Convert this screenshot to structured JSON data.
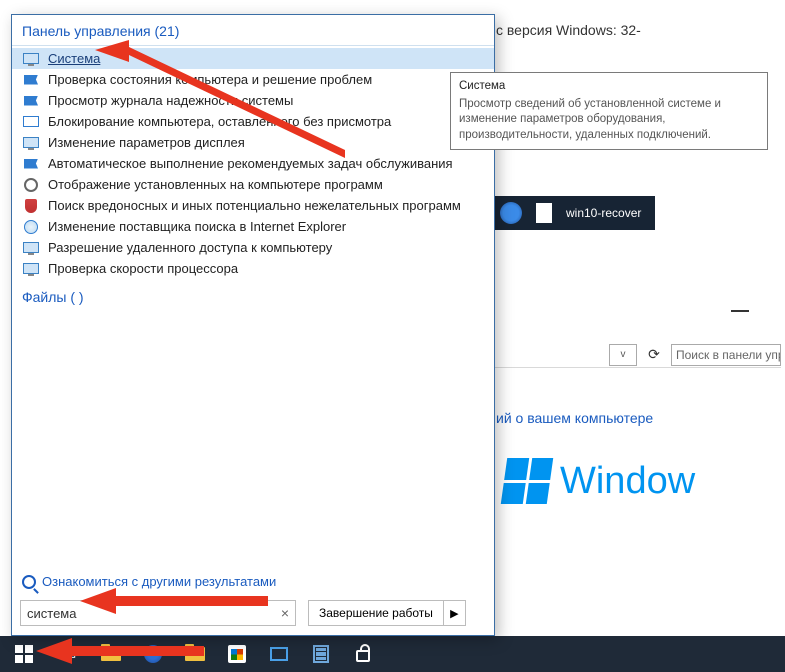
{
  "bg": {
    "win_version": "с версия Windows: 32-",
    "search_cp_placeholder": "Поиск в панели управ",
    "computer_info_link": "ий о вашем компьютере",
    "windows_text": "Window"
  },
  "desktop": {
    "file_name": "win10-recover"
  },
  "start_menu": {
    "section_header": "Панель управления (21)",
    "files_header": "Файлы (   )",
    "more_results": "Ознакомиться с другими результатами",
    "search_value": "система",
    "shutdown_label": "Завершение работы",
    "results": [
      {
        "label": "Система",
        "icon": "ic-monitor",
        "highlight": true,
        "name": "result-system"
      },
      {
        "label": "Проверка состояния компьютера и решение проблем",
        "icon": "ic-flag",
        "name": "result-health-check"
      },
      {
        "label": "Просмотр журнала надежности системы",
        "icon": "ic-flag",
        "name": "result-reliability-log"
      },
      {
        "label": "Блокирование компьютера, оставленного без присмотра",
        "icon": "ic-screen",
        "name": "result-lock-idle"
      },
      {
        "label": "Изменение параметров дисплея",
        "icon": "ic-monitor",
        "name": "result-display-settings"
      },
      {
        "label": "Автоматическое выполнение рекомендуемых задач обслуживания",
        "icon": "ic-flag",
        "name": "result-auto-maintenance"
      },
      {
        "label": "Отображение установленных на компьютере программ",
        "icon": "ic-gear",
        "name": "result-installed-programs"
      },
      {
        "label": "Поиск вредоносных и иных потенциально нежелательных программ",
        "icon": "ic-shield",
        "name": "result-malware-scan"
      },
      {
        "label": "Изменение поставщика поиска в Internet Explorer",
        "icon": "ic-globe",
        "name": "result-ie-search-provider"
      },
      {
        "label": "Разрешение удаленного доступа к компьютеру",
        "icon": "ic-monitor",
        "name": "result-remote-access"
      },
      {
        "label": "Проверка скорости процессора",
        "icon": "ic-monitor",
        "name": "result-cpu-speed"
      }
    ]
  },
  "tooltip": {
    "title": "Система",
    "body": "Просмотр сведений об установленной системе и изменение параметров оборудования, производительности, удаленных подключений."
  }
}
